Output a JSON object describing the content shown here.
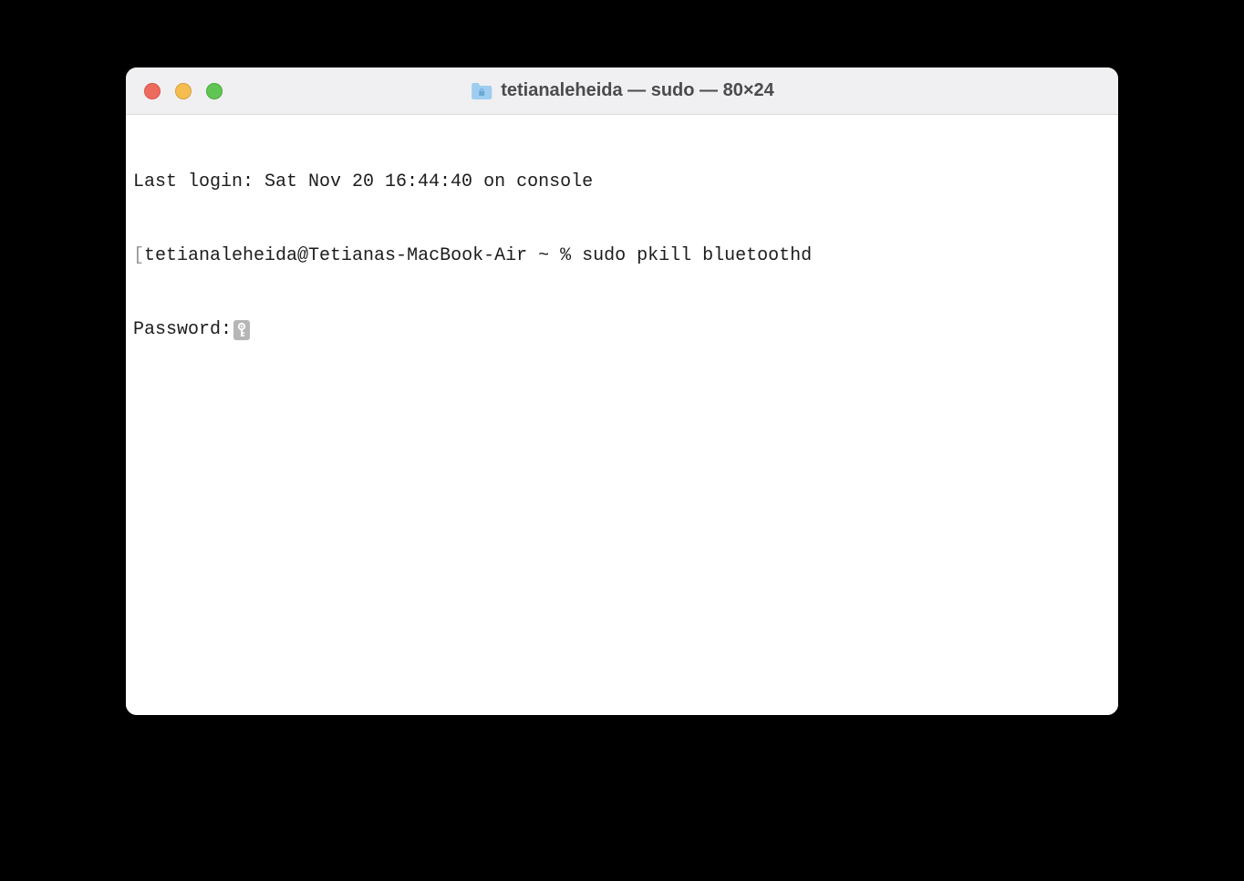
{
  "window": {
    "title": "tetianaleheida — sudo — 80×24"
  },
  "terminal": {
    "lastLoginLine": "Last login: Sat Nov 20 16:44:40 on console",
    "promptBracketLeft": "[",
    "promptUserHost": "tetianaleheida@Tetianas-MacBook-Air ~ % ",
    "promptCommand": "sudo pkill bluetoothd",
    "passwordLabel": "Password:"
  }
}
